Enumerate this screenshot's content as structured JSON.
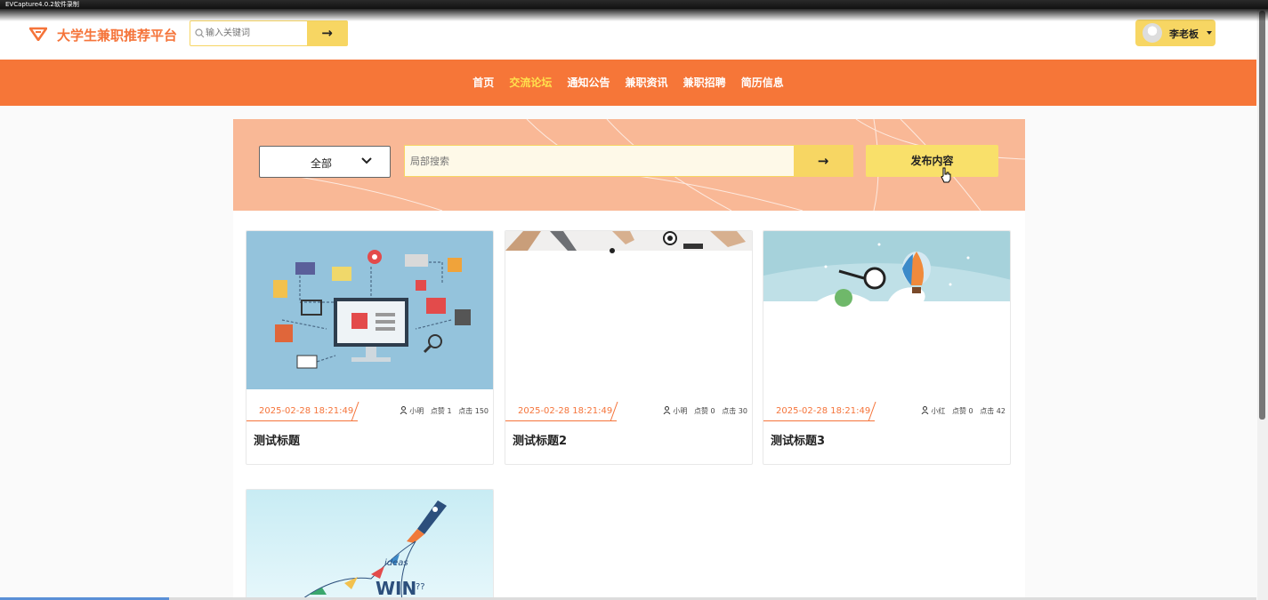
{
  "recorder": {
    "title": "EVCapture4.0.2软件录制"
  },
  "header": {
    "site_title": "大学生兼职推荐平台",
    "search_placeholder": "输入关键词",
    "search_go": "→",
    "user_name": "李老板"
  },
  "nav": {
    "items": [
      "首页",
      "交流论坛",
      "通知公告",
      "兼职资讯",
      "兼职招聘",
      "简历信息"
    ],
    "active": "交流论坛"
  },
  "filter": {
    "category": "全部",
    "search_placeholder": "局部搜索",
    "search_go": "→",
    "publish_label": "发布内容"
  },
  "posts": [
    {
      "date": "2025-02-28 18:21:49",
      "author": "小明",
      "likes_label": "点赞 1",
      "clicks_label": "点击 150",
      "title": "测试标题"
    },
    {
      "date": "2025-02-28 18:21:49",
      "author": "小明",
      "likes_label": "点赞 0",
      "clicks_label": "点击 30",
      "title": "测试标题2"
    },
    {
      "date": "2025-02-28 18:21:49",
      "author": "小红",
      "likes_label": "点赞 0",
      "clicks_label": "点击 42",
      "title": "测试标题3"
    }
  ],
  "colors": {
    "brand_orange": "#f67638",
    "accent_yellow": "#f7d663",
    "active_nav": "#ffe14d",
    "banner_bg": "#f9b896"
  }
}
